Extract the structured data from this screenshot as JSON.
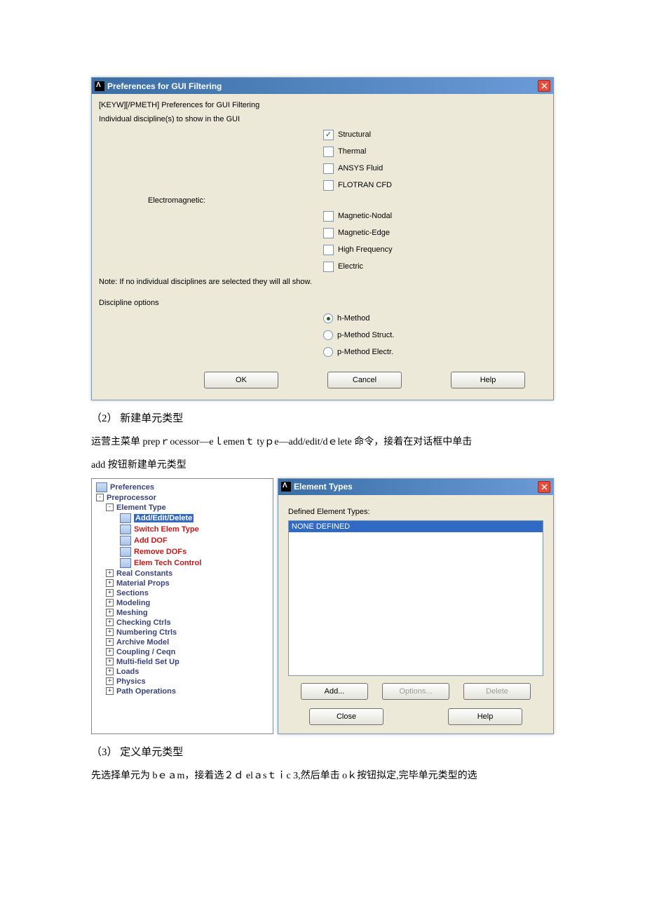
{
  "prefs_dialog": {
    "title": "Preferences for GUI Filtering",
    "subtitle": "[KEYW][/PMETH] Preferences for GUI Filtering",
    "line2": "Individual discipline(s) to show in the GUI",
    "checks": [
      {
        "label": "Structural",
        "checked": true
      },
      {
        "label": "Thermal",
        "checked": false
      },
      {
        "label": "ANSYS Fluid",
        "checked": false
      },
      {
        "label": "FLOTRAN CFD",
        "checked": false
      }
    ],
    "em_label": "Electromagnetic:",
    "em_checks": [
      {
        "label": "Magnetic-Nodal",
        "checked": false
      },
      {
        "label": "Magnetic-Edge",
        "checked": false
      },
      {
        "label": "High Frequency",
        "checked": false
      },
      {
        "label": "Electric",
        "checked": false
      }
    ],
    "note": "Note: If no individual disciplines are selected they will all show.",
    "disc_label": "Discipline options",
    "radios": [
      {
        "label": "h-Method",
        "selected": true
      },
      {
        "label": "p-Method Struct.",
        "selected": false
      },
      {
        "label": "p-Method Electr.",
        "selected": false
      }
    ],
    "buttons": {
      "ok": "OK",
      "cancel": "Cancel",
      "help": "Help"
    }
  },
  "text": {
    "step2": "（2）  新建单元类型",
    "p1": "运营主菜单 prepｒocessor—eｌemenｔ tyｐe—add/edit/dｅlete 命令，接着在对话框中单击",
    "p2": "add 按钮新建单元类型",
    "step3": "（3）  定义单元类型",
    "p3": "先选择单元为 bｅａm，接着选２ｄ elａsｔｉc 3,然后单击 oｋ按钮拟定,完毕单元类型的选"
  },
  "tree": {
    "preferences": "Preferences",
    "preprocessor": "Preprocessor",
    "element_type": "Element Type",
    "add_edit_delete": "Add/Edit/Delete",
    "switch_elem": "Switch Elem Type",
    "add_dof": "Add DOF",
    "remove_dofs": "Remove DOFs",
    "elem_tech": "Elem Tech Control",
    "items": [
      "Real Constants",
      "Material Props",
      "Sections",
      "Modeling",
      "Meshing",
      "Checking Ctrls",
      "Numbering Ctrls",
      "Archive Model",
      "Coupling / Ceqn",
      "Multi-field Set Up",
      "Loads",
      "Physics",
      "Path Operations"
    ]
  },
  "etypes": {
    "title": "Element Types",
    "defined_label": "Defined Element Types:",
    "none": "NONE DEFINED",
    "buttons": {
      "add": "Add...",
      "options": "Options...",
      "delete": "Delete",
      "close": "Close",
      "help": "Help"
    }
  }
}
